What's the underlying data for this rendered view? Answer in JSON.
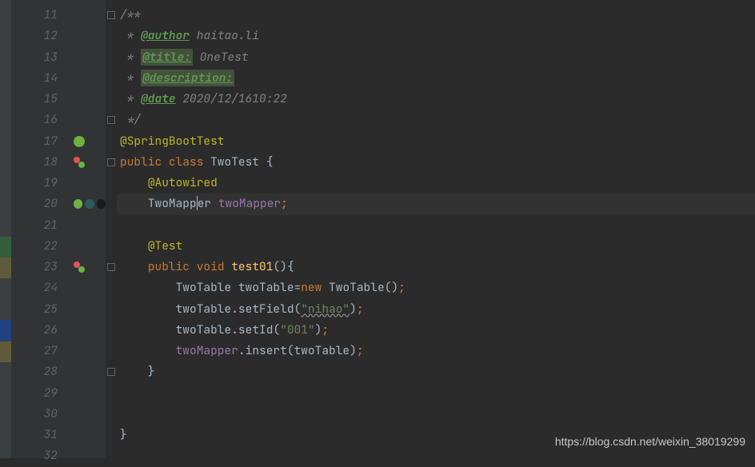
{
  "gutter": [
    "11",
    "12",
    "13",
    "14",
    "15",
    "16",
    "17",
    "18",
    "19",
    "20",
    "21",
    "22",
    "23",
    "24",
    "25",
    "26",
    "27",
    "28",
    "29",
    "30",
    "31",
    "32"
  ],
  "code": {
    "l11": {
      "c1": "/**"
    },
    "l12": {
      "c1": " * ",
      "tag": "@author",
      "c2": " haitao.li"
    },
    "l13": {
      "c1": " * ",
      "tag": "@title:",
      "c2": " OneTest"
    },
    "l14": {
      "c1": " * ",
      "tag": "@description:"
    },
    "l15": {
      "c1": " * ",
      "tag": "@date",
      "c2": " 2020/12/1610:22"
    },
    "l16": {
      "c1": " */"
    },
    "l17": {
      "ann": "@SpringBootTest"
    },
    "l18": {
      "k1": "public ",
      "k2": "class ",
      "cn": "TwoTest ",
      "p": "{"
    },
    "l19": {
      "pad": "    ",
      "ann": "@Autowired"
    },
    "l20": {
      "pad": "    ",
      "cn1": "TwoMapp",
      "cn2": "er ",
      "f": "twoMapper",
      "p": ";"
    },
    "l22": {
      "pad": "    ",
      "ann": "@Test"
    },
    "l23": {
      "pad": "    ",
      "k1": "public ",
      "k2": "void ",
      "m": "test01",
      "p1": "()",
      "p2": "{"
    },
    "l24": {
      "pad": "        ",
      "cn1": "TwoTable ",
      "v": "twoTable",
      "eq": "=",
      "k": "new ",
      "cn2": "TwoTable",
      "p1": "()",
      "p2": ";"
    },
    "l25": {
      "pad": "        ",
      "v": "twoTable",
      "dot": ".",
      "m": "setField",
      "p1": "(",
      "s": "\"nihao\"",
      "p2": ")",
      "p3": ";"
    },
    "l26": {
      "pad": "        ",
      "v": "twoTable",
      "dot": ".",
      "m": "setId",
      "p1": "(",
      "s": "\"001\"",
      "p2": ")",
      "p3": ";"
    },
    "l27": {
      "pad": "        ",
      "f": "twoMapper",
      "dot": ".",
      "m": "insert",
      "p1": "(",
      "v": "twoTable",
      "p2": ")",
      "p3": ";"
    },
    "l28": {
      "pad": "    ",
      "p": "}"
    },
    "l31": {
      "p": "}"
    }
  },
  "watermark": "https://blog.csdn.net/weixin_38019299"
}
